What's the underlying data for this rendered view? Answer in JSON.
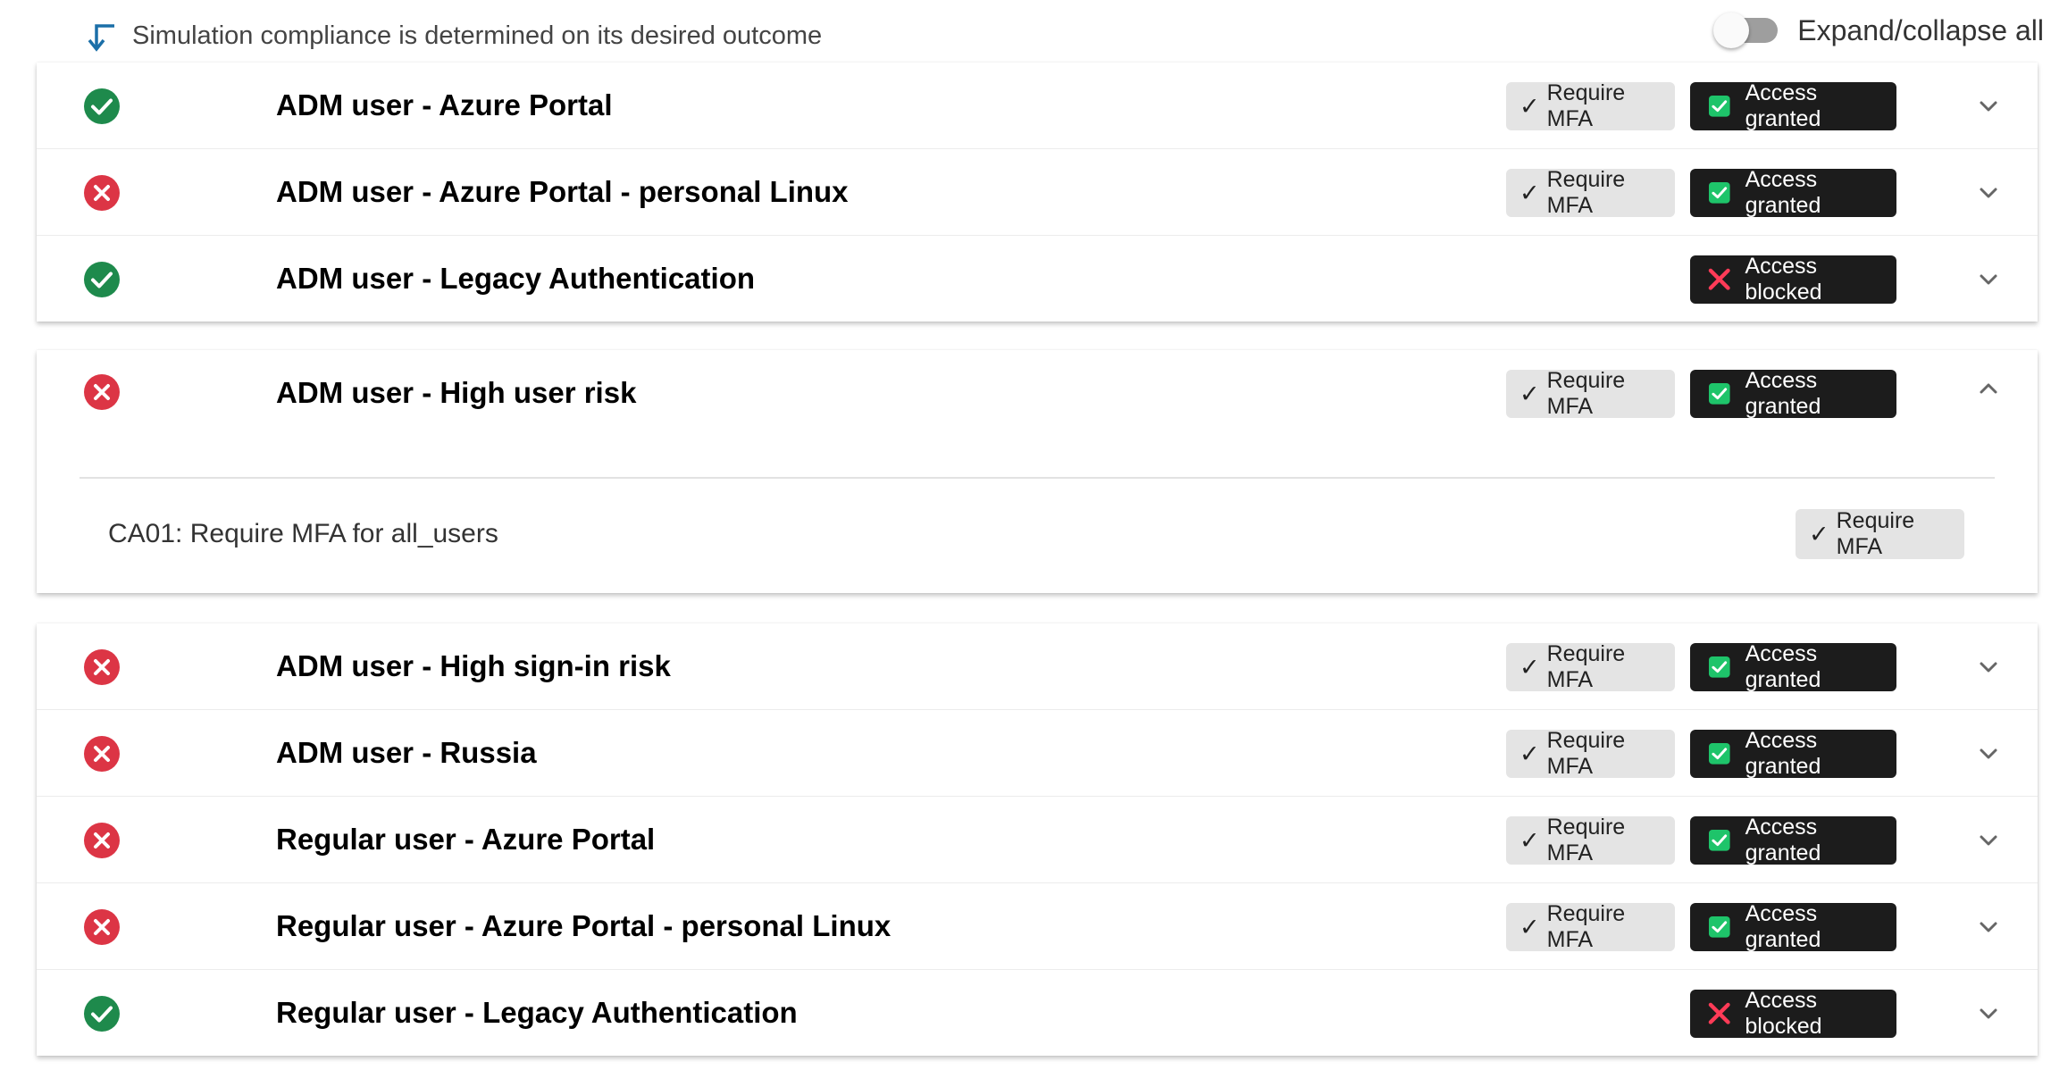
{
  "header": {
    "hint": "Simulation compliance is determined on its desired outcome",
    "hint_icon": "arrow-down-left-icon",
    "toggle_label": "Expand/collapse all",
    "toggle_on": false
  },
  "colors": {
    "pass": "#1e8a4c",
    "fail": "#dc3545",
    "access_bg": "#1c1c1c",
    "mfa_bg": "#e4e4e4",
    "granted_icon": "#1ec46a",
    "blocked_icon": "#ff3b57"
  },
  "groups": [
    {
      "rows": [
        {
          "title": "ADM user - Azure Portal",
          "status": "pass",
          "mfa": "Require MFA",
          "access": "Access granted",
          "access_type": "granted",
          "expanded": false
        },
        {
          "title": "ADM user - Azure Portal - personal Linux",
          "status": "fail",
          "mfa": "Require MFA",
          "access": "Access granted",
          "access_type": "granted",
          "expanded": false
        },
        {
          "title": "ADM user - Legacy Authentication",
          "status": "pass",
          "mfa": null,
          "access": "Access blocked",
          "access_type": "blocked",
          "expanded": false
        }
      ]
    },
    {
      "rows": [
        {
          "title": "ADM user - High user risk",
          "status": "fail",
          "mfa": "Require MFA",
          "access": "Access granted",
          "access_type": "granted",
          "expanded": true
        }
      ],
      "details": [
        {
          "policy": "CA01: Require MFA for all_users",
          "control": "Require MFA"
        }
      ]
    },
    {
      "rows": [
        {
          "title": "ADM user - High sign-in risk",
          "status": "fail",
          "mfa": "Require MFA",
          "access": "Access granted",
          "access_type": "granted",
          "expanded": false
        },
        {
          "title": "ADM user - Russia",
          "status": "fail",
          "mfa": "Require MFA",
          "access": "Access granted",
          "access_type": "granted",
          "expanded": false
        },
        {
          "title": "Regular user - Azure Portal",
          "status": "fail",
          "mfa": "Require MFA",
          "access": "Access granted",
          "access_type": "granted",
          "expanded": false
        },
        {
          "title": "Regular user - Azure Portal - personal Linux",
          "status": "fail",
          "mfa": "Require MFA",
          "access": "Access granted",
          "access_type": "granted",
          "expanded": false
        },
        {
          "title": "Regular user - Legacy Authentication",
          "status": "pass",
          "mfa": null,
          "access": "Access blocked",
          "access_type": "blocked",
          "expanded": false
        }
      ]
    }
  ]
}
